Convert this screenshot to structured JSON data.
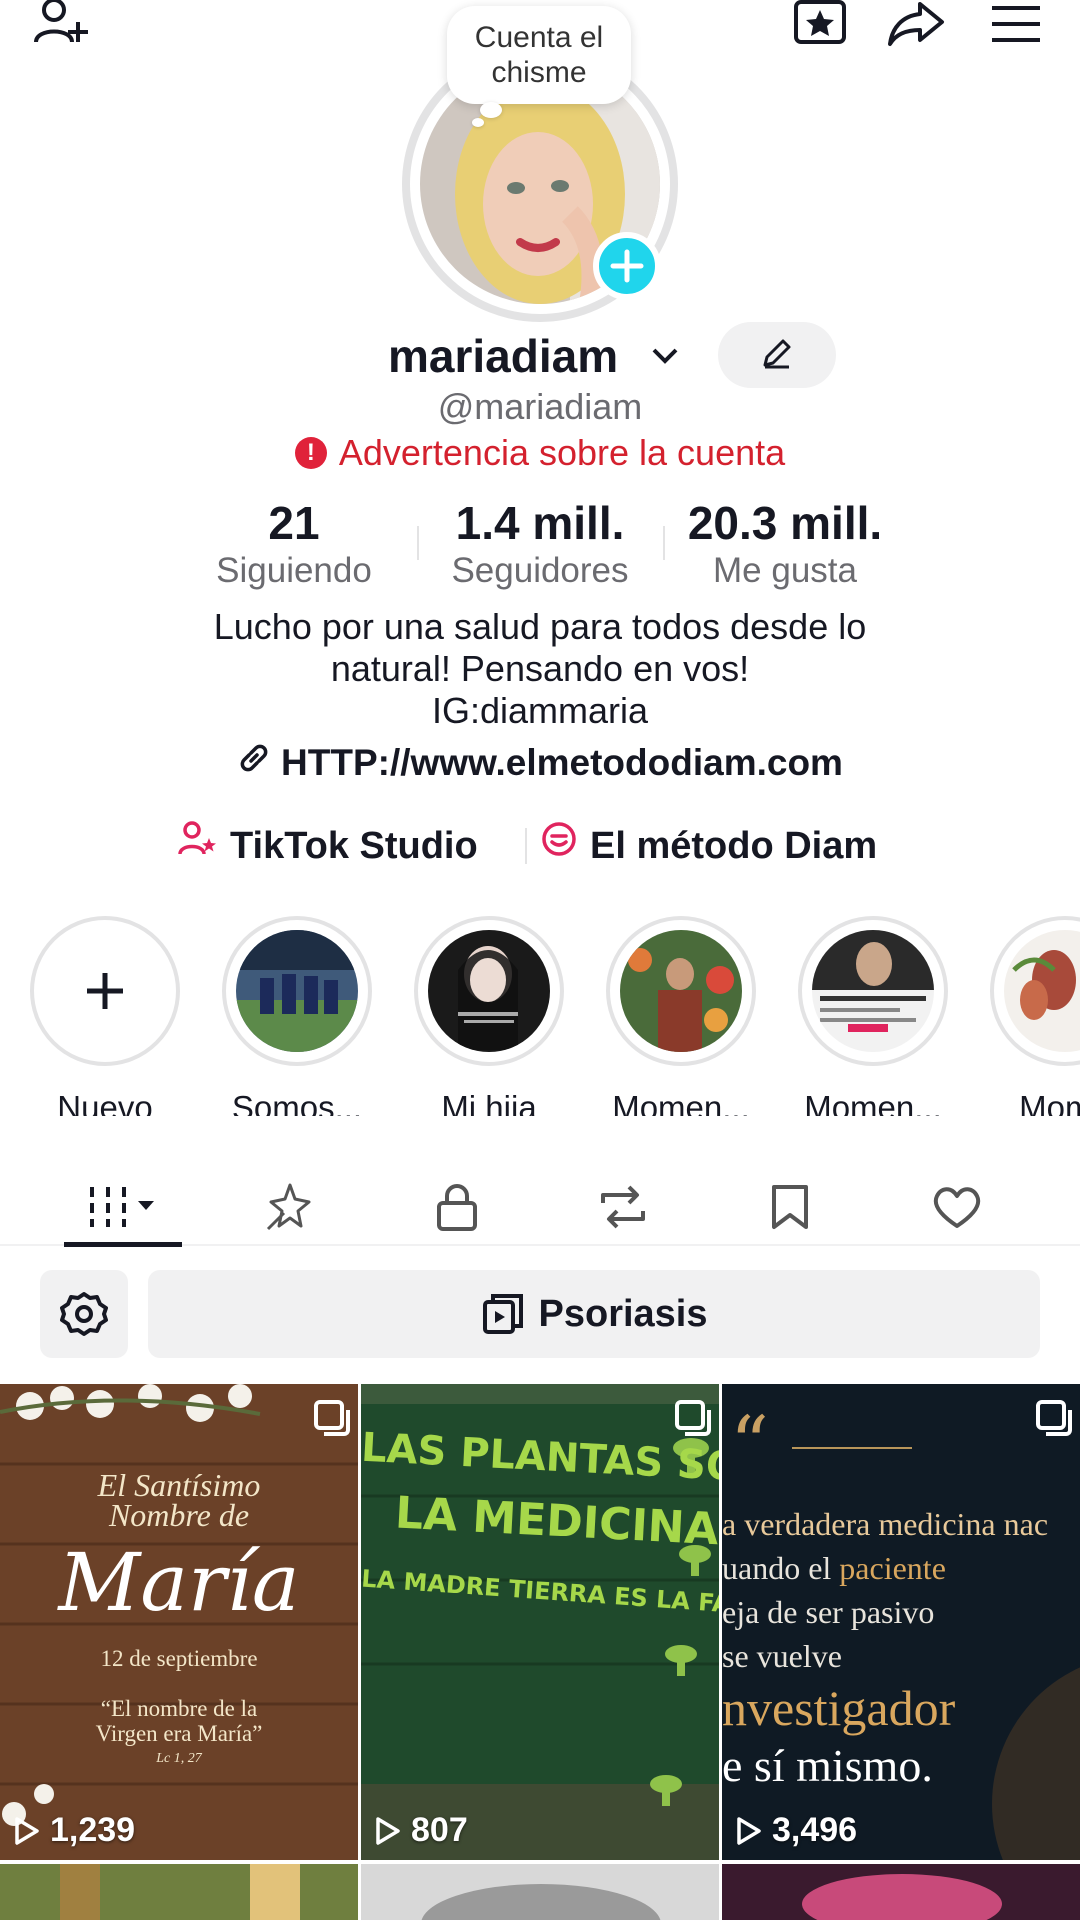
{
  "profile": {
    "note": "Cuenta el chisme",
    "username": "mariadiam",
    "handle": "@mariadiam",
    "warning": "Advertencia sobre la cuenta"
  },
  "stats": [
    {
      "value": "21",
      "label": "Siguiendo"
    },
    {
      "value": "1.4 mill.",
      "label": "Seguidores"
    },
    {
      "value": "20.3 mill.",
      "label": "Me gusta"
    }
  ],
  "bio": {
    "line1": "Lucho por una salud para todos desde lo",
    "line2": "natural! Pensando en vos!",
    "line3": "IG:diammaria",
    "link": "HTTP://www.elmetododiam.com"
  },
  "tools": {
    "studio": "TikTok Studio",
    "method": "El método Diam"
  },
  "highlights": [
    {
      "label": "Nuevo"
    },
    {
      "label": "Somos..."
    },
    {
      "label": "Mi hija"
    },
    {
      "label": "Momen..."
    },
    {
      "label": "Momen..."
    },
    {
      "label": "Mome"
    }
  ],
  "playlist": {
    "label": "Psoriasis"
  },
  "videos": [
    {
      "views": "1,239",
      "title1": "El Santísimo",
      "title2": "Nombre de",
      "title3": "María",
      "title4": "12 de septiembre",
      "title5": "“El nombre de la",
      "title6": "Virgen era María”",
      "title7": "Lc 1, 27"
    },
    {
      "views": "807",
      "title1": "LAS PLANTAS SON",
      "title2": "LA MEDICINA,",
      "title3": "LA MADRE TIERRA ES LA FARMACIA"
    },
    {
      "views": "3,496",
      "title1": "a verdadera medicina nac",
      "title2": "uando el",
      "title2b": "paciente",
      "title3": "eja de ser pasivo",
      "title4": "se vuelve",
      "title5": "nvestigador",
      "title6": "e sí mismo."
    }
  ],
  "colors": {
    "accent_cyan": "#20d5ec",
    "warning_red": "#d4212e",
    "text": "#161823",
    "muted": "#6b6b70"
  }
}
